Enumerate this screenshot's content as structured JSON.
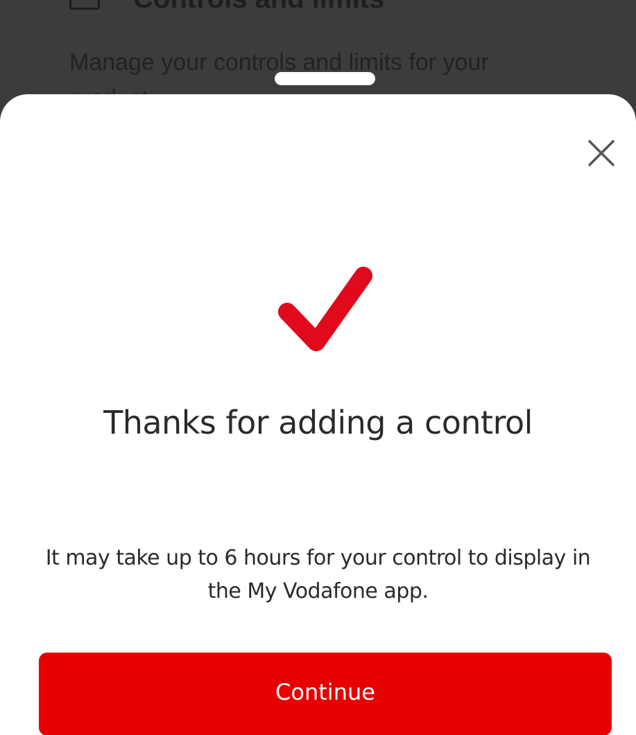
{
  "background": {
    "heading": "Controls and limits",
    "description": "Manage your controls and limits for your product"
  },
  "sheet": {
    "close_icon": "close-icon",
    "success_icon": "checkmark-icon",
    "title": "Thanks for adding a control",
    "message": "It may take up to 6 hours for your control to display in the My Vodafone app.",
    "continue_label": "Continue"
  },
  "colors": {
    "brand_red": "#e60000",
    "checkmark_red": "#e00a1c",
    "backdrop": "#3c3c3c"
  }
}
